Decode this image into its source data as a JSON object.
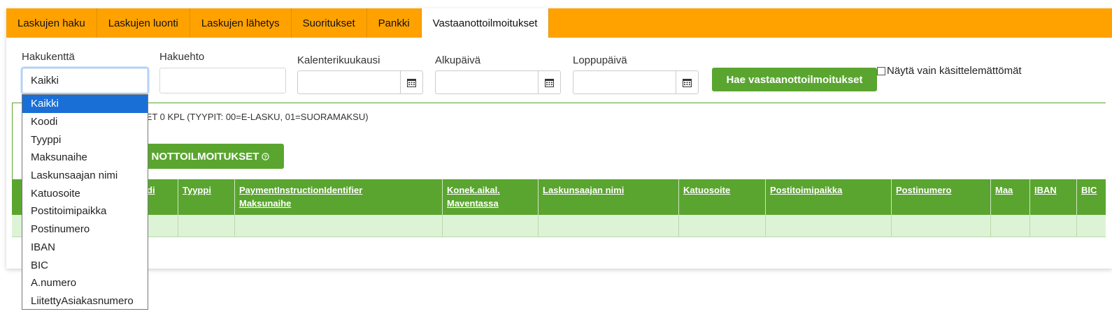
{
  "tabs": [
    {
      "label": "Laskujen haku"
    },
    {
      "label": "Laskujen luonti"
    },
    {
      "label": "Laskujen lähetys"
    },
    {
      "label": "Suoritukset"
    },
    {
      "label": "Pankki"
    },
    {
      "label": "Vastaanottoilmoitukset",
      "active": true
    }
  ],
  "filters": {
    "hakukentta_label": "Hakukenttä",
    "hakukentta_value": "Kaikki",
    "hakuehto_label": "Hakuehto",
    "hakuehto_value": "",
    "kalenterikuukausi_label": "Kalenterikuukausi",
    "alkupaiva_label": "Alkupäivä",
    "loppupaiva_label": "Loppupäivä",
    "search_button": "Hae vastaanottoilmoitukset",
    "only_unhandled_label": "Näytä vain käsittelemättömät"
  },
  "result": {
    "count_text": "SET 0 KPL (TYYPIT: 00=E-LASKU, 01=SUORAMAKSU)",
    "action_button": "NOTTOILMOITUKSET",
    "action_icon": "help-circle-icon"
  },
  "table": {
    "columns": [
      {
        "line1": "di",
        "line2": ""
      },
      {
        "line1": "Tyyppi",
        "line2": ""
      },
      {
        "line1": "PaymentInstructionIdentifier",
        "line2": "Maksunaihe"
      },
      {
        "line1": "Konek.aikal.",
        "line2": "Maventassa"
      },
      {
        "line1": "Laskunsaajan nimi",
        "line2": ""
      },
      {
        "line1": "Katuosoite",
        "line2": ""
      },
      {
        "line1": "Postitoimipaikka",
        "line2": ""
      },
      {
        "line1": "Postinumero",
        "line2": ""
      },
      {
        "line1": "Maa",
        "line2": ""
      },
      {
        "line1": "IBAN",
        "line2": ""
      },
      {
        "line1": "BIC",
        "line2": ""
      }
    ]
  },
  "dropdown": {
    "options": [
      "Kaikki",
      "Koodi",
      "Tyyppi",
      "Maksunaihe",
      "Laskunsaajan nimi",
      "Katuosoite",
      "Postitoimipaikka",
      "Postinumero",
      "IBAN",
      "BIC",
      "A.numero",
      "LiitettyAsiakasnumero"
    ],
    "selected_index": 0
  },
  "colors": {
    "tabbar": "#ffa200",
    "green": "#5aa52f",
    "row": "#ddf3d6",
    "selected": "#1a6fd6"
  }
}
